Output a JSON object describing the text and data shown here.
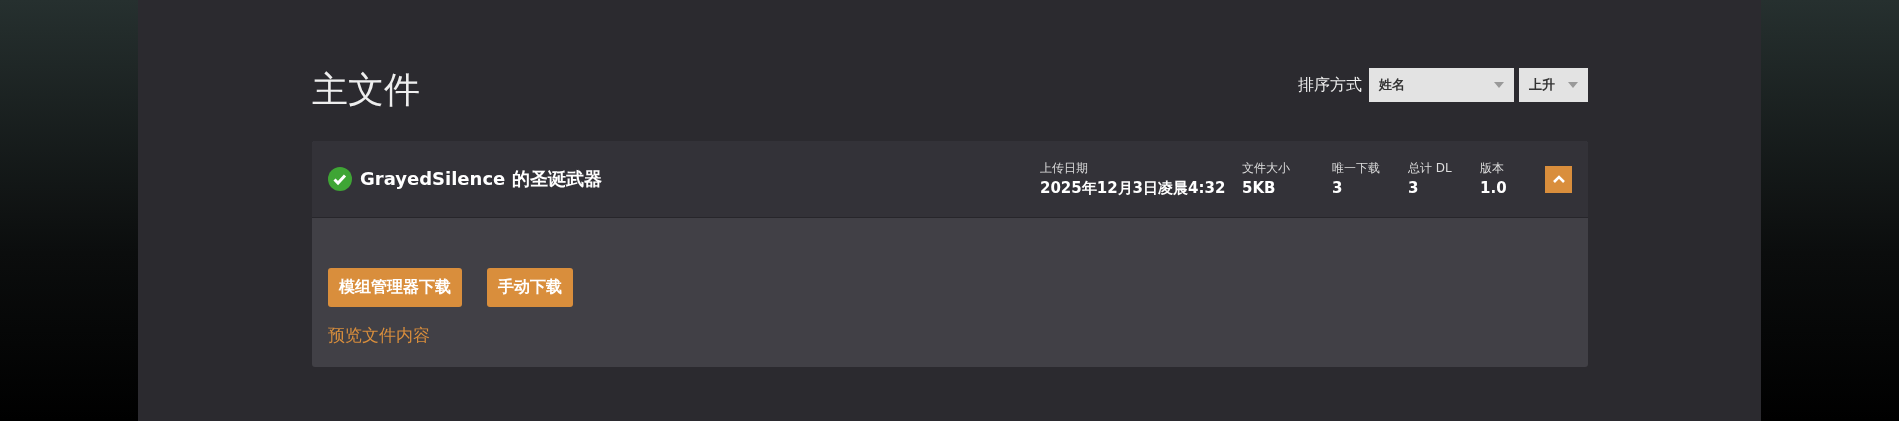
{
  "heading": "主文件",
  "sort": {
    "label": "排序方式",
    "field": "姓名",
    "order": "上升"
  },
  "file": {
    "verified": true,
    "name": "GrayedSilence 的圣诞武器",
    "expanded": true,
    "meta": [
      {
        "label": "上传日期",
        "value": "2025年12月3日凌晨4:32"
      },
      {
        "label": "文件大小",
        "value": "5KB"
      },
      {
        "label": "唯一下载",
        "value": "3"
      },
      {
        "label": "总计 DL",
        "value": "3"
      },
      {
        "label": "版本",
        "value": "1.0"
      }
    ],
    "buttons": [
      "模组管理器下载",
      "手动下载"
    ],
    "preview_link": "预览文件内容"
  }
}
